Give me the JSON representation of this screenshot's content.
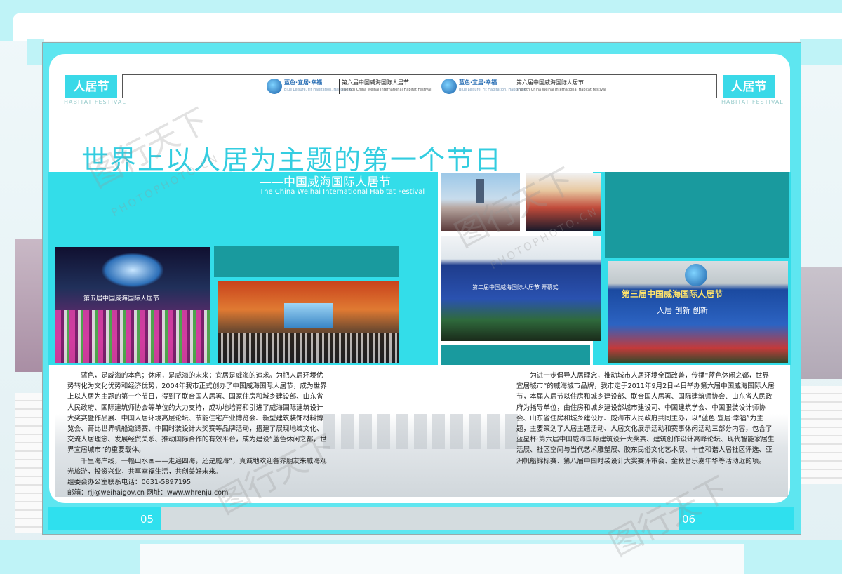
{
  "brand": {
    "tag": "人居节",
    "tag_sub": "HABITAT FESTIVAL"
  },
  "banner": {
    "slogan": "蓝色·宜居·幸福",
    "slogan_en": "Blue Leisure, Fit Habitation, Happiness",
    "festival": "第六届中国威海国际人居节",
    "festival_en": "The 6th China Weihai International Habitat Festival"
  },
  "headline": {
    "title": "世界上以人居为主题的第一个节日",
    "subtitle": "——中国威海国际人居节",
    "subtitle_en": "The China Weihai International Habitat Festival"
  },
  "left_column": {
    "p1": "蓝色，是威海的本色；休闲，是威海的未来；宜居是威海的追求。为把人居环境优势转化为文化优势和经济优势，2004年我市正式创办了中国威海国际人居节，成为世界上以人居为主题的第一个节日，得到了联合国人居署、国家住房和城乡建设部、山东省人民政府、国际建筑师协会等单位的大力支持，成功地培育和引进了威海国际建筑设计大奖赛暨作品展、中国人居环境高层论坛、节能住宅产业博览会、新型建筑装饰材料博览会、菁比世界帆船邀请赛、中国时装设计大奖赛等品牌活动，搭建了展现地域文化、交流人居理念、发展经贸关系、推动国际合作的有效平台，成为建设“蓝色休闲之都，世界宜居城市”的重要载体。",
    "p2": "千里海岸线，一幅山水画——走遍四海，还是威海”，真诚地欢迎各界朋友来威海观光旅游，投资兴业，共享幸福生活，共创美好未来。",
    "contact_phone": "组委会办公室联系电话：0631-5897195",
    "contact_mail": "邮箱：rjj@weihaigov.cn  网址：www.whrenju.com"
  },
  "right_column": {
    "p1": "为进一步倡导人居理念，推动城市人居环境全面改善，传播“蓝色休闲之都，世界宜居城市”的威海城市品牌，我市定于2011年9月2日-4日举办第六届中国威海国际人居节，本届人居节以住房和城乡建设部、联合国人居署、国际建筑师协会、山东省人民政府为指导单位，由住房和城乡建设部城市建设司、中国建筑学会、中国服装设计师协会、山东省住房和城乡建设厅、威海市人民政府共同主办，以“蓝色·宜居·幸福”为主题，主要策划了人居主题活动、人居文化展示活动和赛事休闲活动三部分内容，包含了蓝星杯·第六届中国威海国际建筑设计大奖赛、建筑创作设计高峰论坛、现代智能家居生活展、社区空间与当代艺术雕塑展、胶东民俗文化艺术展、十佳和谐人居社区评选、亚洲帆船锦标赛、第八届中国时装设计大奖赛评审会、金秋音乐嘉年华等活动近的项。"
  },
  "photos": {
    "stage_banner": "第三届中国威海国际人居节",
    "stage_slogan": "人居 创新 创新",
    "opening_banner": "第二届中国威海国际人居节 开幕式",
    "stage_left_banner": "第五届中国威海国际人居节"
  },
  "footer": {
    "page_left": "05",
    "page_right": "06"
  },
  "watermark": {
    "text": "图行天下",
    "site": "PHOTOPHOTO.CN"
  },
  "colors": {
    "accent": "#33cde0",
    "page_frame": "#5ee6f0",
    "teal_block": "#199a9e"
  }
}
